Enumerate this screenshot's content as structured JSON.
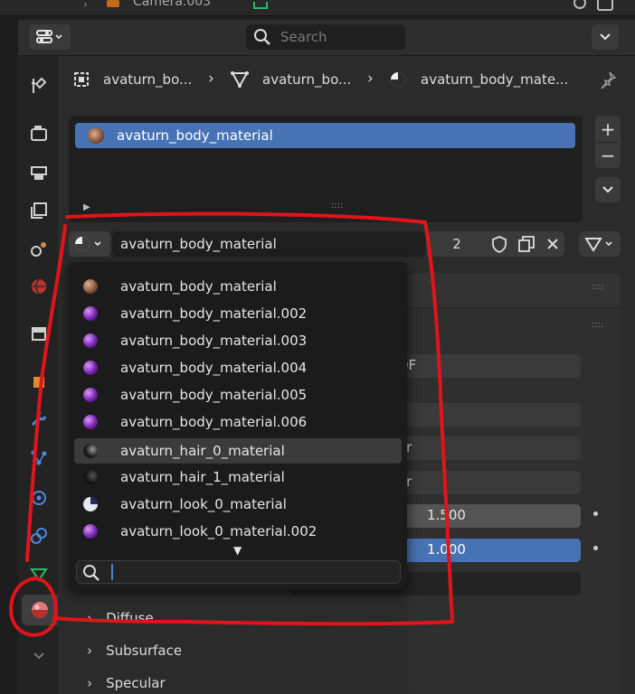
{
  "outliner": {
    "item_label": "Camera.003"
  },
  "header": {
    "search_placeholder": "Search"
  },
  "breadcrumb": {
    "object": "avaturn_bo...",
    "mesh": "avaturn_bo...",
    "material": "avaturn_body_mate..."
  },
  "slots": {
    "items": [
      {
        "label": "avaturn_body_material"
      }
    ],
    "add_label": "+",
    "remove_label": "−"
  },
  "material_selector": {
    "name": "avaturn_body_material",
    "users": "2"
  },
  "dropdown": {
    "items": [
      {
        "label": "avaturn_body_material",
        "icon": "skin-material-icon"
      },
      {
        "label": "avaturn_body_material.002",
        "icon": "purple-sphere-icon"
      },
      {
        "label": "avaturn_body_material.003",
        "icon": "purple-sphere-icon"
      },
      {
        "label": "avaturn_body_material.004",
        "icon": "purple-sphere-icon"
      },
      {
        "label": "avaturn_body_material.005",
        "icon": "purple-sphere-icon"
      },
      {
        "label": "avaturn_body_material.006",
        "icon": "purple-sphere-icon"
      },
      {
        "label": "avaturn_hair_0_material",
        "icon": "dark-hair-icon"
      },
      {
        "label": "avaturn_hair_1_material",
        "icon": "dark-hair-icon"
      },
      {
        "label": "avaturn_look_0_material",
        "icon": "look-material-icon"
      },
      {
        "label": "avaturn_look_0_material.002",
        "icon": "purple-sphere-icon"
      }
    ],
    "hover_index": 6,
    "search_value": ""
  },
  "background_fields": {
    "surface_suffix": "DF",
    "field_a_suffix": "or",
    "field_b_suffix": "or",
    "ior_value": "1.500",
    "alpha_value": "1.000"
  },
  "sections": [
    {
      "label": "Diffuse"
    },
    {
      "label": "Subsurface"
    },
    {
      "label": "Specular"
    }
  ],
  "colors": {
    "accent": "#4772b3",
    "annotation": "#e0141a",
    "purple_material": "#8a2fc0"
  }
}
